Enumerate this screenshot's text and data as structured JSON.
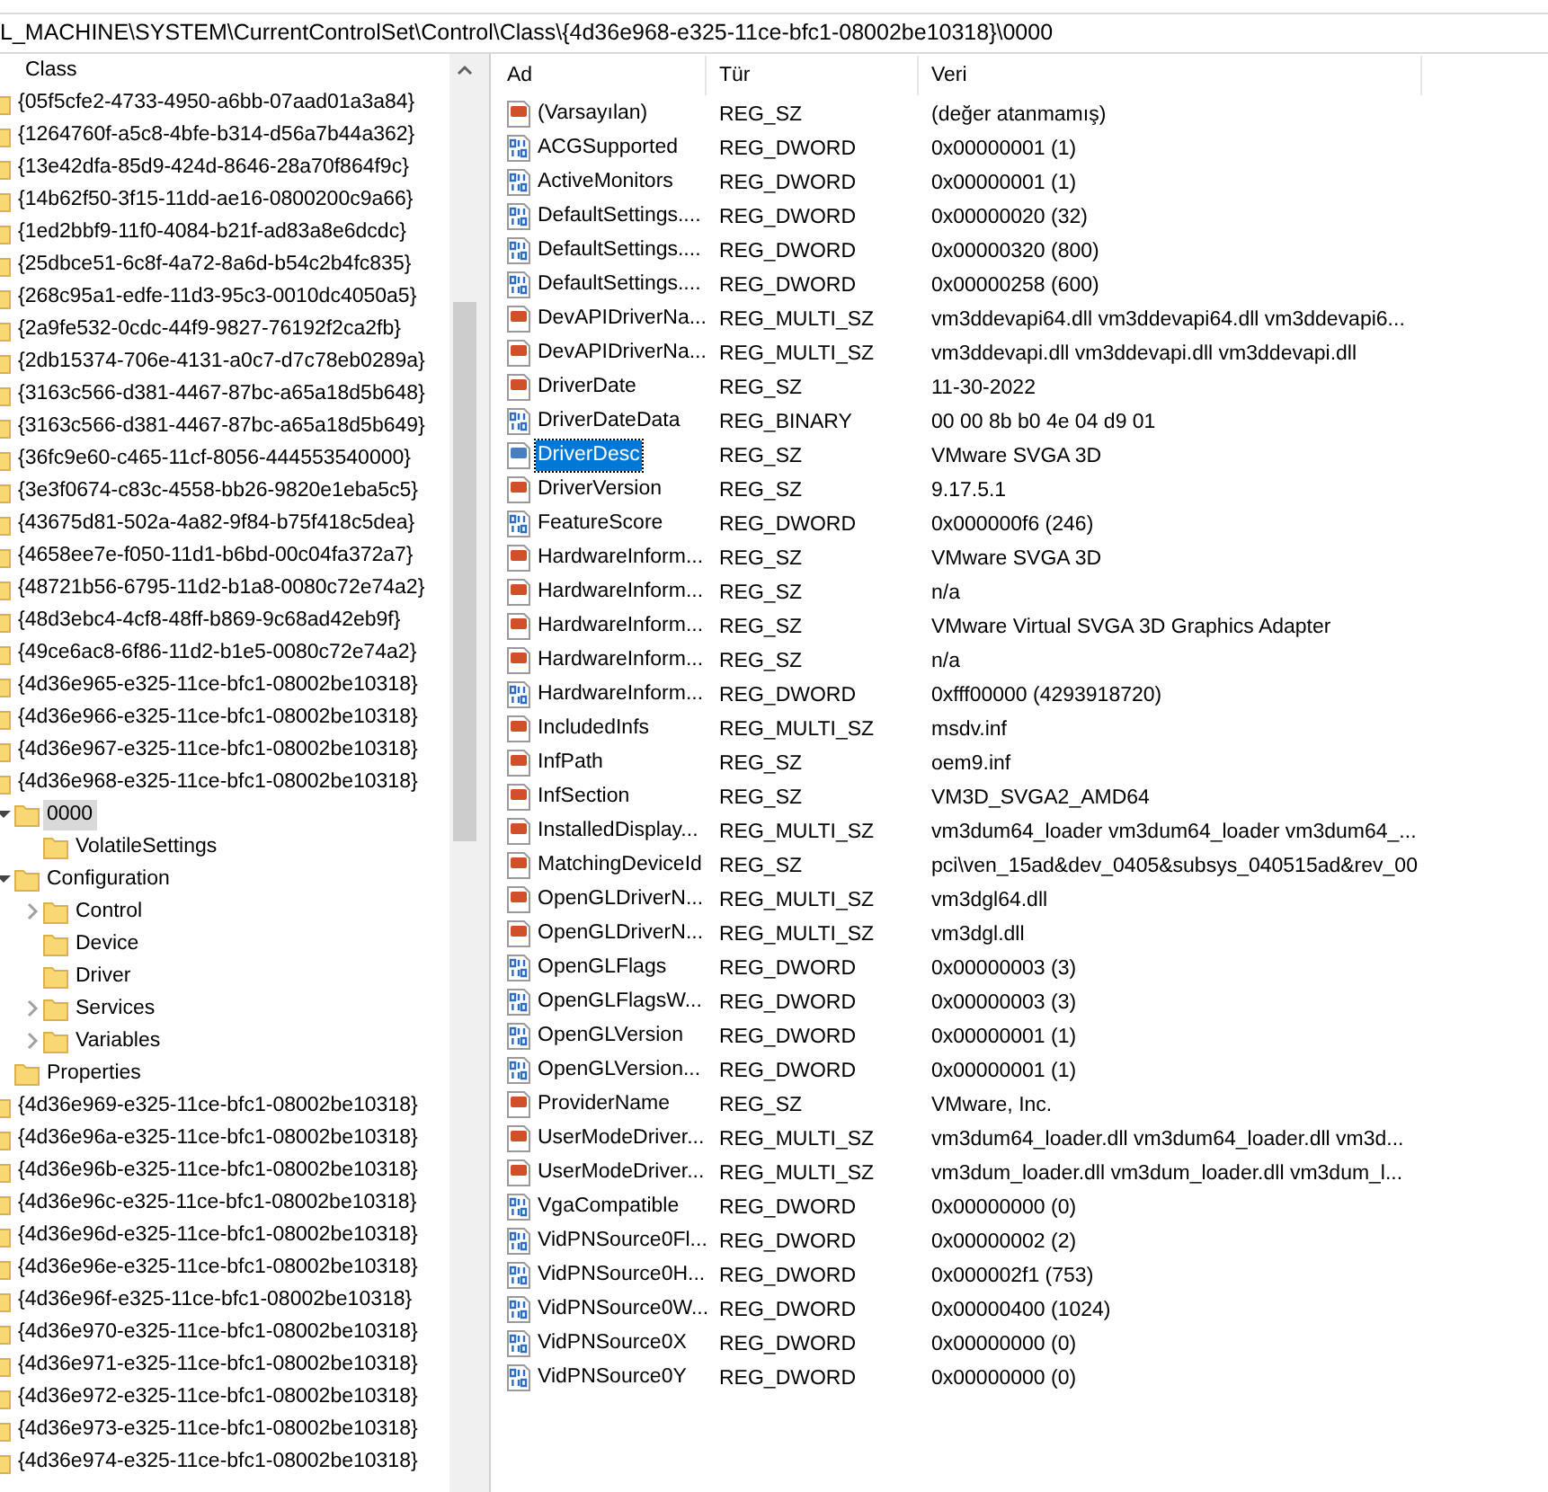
{
  "address_bar": {
    "path": "L_MACHINE\\SYSTEM\\CurrentControlSet\\Control\\Class\\{4d36e968-e325-11ce-bfc1-08002be10318}\\0000"
  },
  "tree": {
    "label": "Class",
    "selected": false,
    "children": [
      {
        "label": "{05f5cfe2-4733-4950-a6bb-07aad01a3a84}",
        "selected": false
      },
      {
        "label": "{1264760f-a5c8-4bfe-b314-d56a7b44a362}",
        "selected": false
      },
      {
        "label": "{13e42dfa-85d9-424d-8646-28a70f864f9c}",
        "selected": false
      },
      {
        "label": "{14b62f50-3f15-11dd-ae16-0800200c9a66}",
        "selected": false
      },
      {
        "label": "{1ed2bbf9-11f0-4084-b21f-ad83a8e6dcdc}",
        "selected": false
      },
      {
        "label": "{25dbce51-6c8f-4a72-8a6d-b54c2b4fc835}",
        "selected": false
      },
      {
        "label": "{268c95a1-edfe-11d3-95c3-0010dc4050a5}",
        "selected": false
      },
      {
        "label": "{2a9fe532-0cdc-44f9-9827-76192f2ca2fb}",
        "selected": false
      },
      {
        "label": "{2db15374-706e-4131-a0c7-d7c78eb0289a}",
        "selected": false
      },
      {
        "label": "{3163c566-d381-4467-87bc-a65a18d5b648}",
        "selected": false
      },
      {
        "label": "{3163c566-d381-4467-87bc-a65a18d5b649}",
        "selected": false
      },
      {
        "label": "{36fc9e60-c465-11cf-8056-444553540000}",
        "selected": false
      },
      {
        "label": "{3e3f0674-c83c-4558-bb26-9820e1eba5c5}",
        "selected": false
      },
      {
        "label": "{43675d81-502a-4a82-9f84-b75f418c5dea}",
        "selected": false
      },
      {
        "label": "{4658ee7e-f050-11d1-b6bd-00c04fa372a7}",
        "selected": false
      },
      {
        "label": "{48721b56-6795-11d2-b1a8-0080c72e74a2}",
        "selected": false
      },
      {
        "label": "{48d3ebc4-4cf8-48ff-b869-9c68ad42eb9f}",
        "selected": false
      },
      {
        "label": "{49ce6ac8-6f86-11d2-b1e5-0080c72e74a2}",
        "selected": false
      },
      {
        "label": "{4d36e965-e325-11ce-bfc1-08002be10318}",
        "selected": false
      },
      {
        "label": "{4d36e966-e325-11ce-bfc1-08002be10318}",
        "selected": false
      },
      {
        "label": "{4d36e967-e325-11ce-bfc1-08002be10318}",
        "selected": false
      },
      {
        "label": "{4d36e968-e325-11ce-bfc1-08002be10318}",
        "selected": false,
        "children": [
          {
            "label": "0000",
            "expanded": true,
            "selected": true,
            "children": [
              {
                "label": "VolatileSettings",
                "selected": false
              }
            ]
          },
          {
            "label": "Configuration",
            "expanded": true,
            "selected": false,
            "children": [
              {
                "label": "Control",
                "expanded": false,
                "selected": false
              },
              {
                "label": "Device",
                "selected": false
              },
              {
                "label": "Driver",
                "selected": false
              },
              {
                "label": "Services",
                "expanded": false,
                "selected": false
              },
              {
                "label": "Variables",
                "expanded": false,
                "selected": false
              }
            ]
          },
          {
            "label": "Properties",
            "selected": false
          }
        ]
      },
      {
        "label": "{4d36e969-e325-11ce-bfc1-08002be10318}",
        "selected": false
      },
      {
        "label": "{4d36e96a-e325-11ce-bfc1-08002be10318}",
        "selected": false
      },
      {
        "label": "{4d36e96b-e325-11ce-bfc1-08002be10318}",
        "selected": false
      },
      {
        "label": "{4d36e96c-e325-11ce-bfc1-08002be10318}",
        "selected": false
      },
      {
        "label": "{4d36e96d-e325-11ce-bfc1-08002be10318}",
        "selected": false
      },
      {
        "label": "{4d36e96e-e325-11ce-bfc1-08002be10318}",
        "selected": false
      },
      {
        "label": "{4d36e96f-e325-11ce-bfc1-08002be10318}",
        "selected": false
      },
      {
        "label": "{4d36e970-e325-11ce-bfc1-08002be10318}",
        "selected": false
      },
      {
        "label": "{4d36e971-e325-11ce-bfc1-08002be10318}",
        "selected": false
      },
      {
        "label": "{4d36e972-e325-11ce-bfc1-08002be10318}",
        "selected": false
      },
      {
        "label": "{4d36e973-e325-11ce-bfc1-08002be10318}",
        "selected": false
      },
      {
        "label": "{4d36e974-e325-11ce-bfc1-08002be10318}",
        "selected": false
      }
    ]
  },
  "values_list": {
    "columns": [
      "Ad",
      "Tür",
      "Veri"
    ],
    "rows": [
      {
        "kind": "string",
        "name": "(Varsayılan)",
        "type": "REG_SZ",
        "data": "(değer atanmamış)",
        "selected": false
      },
      {
        "kind": "binary",
        "name": "ACGSupported",
        "type": "REG_DWORD",
        "data": "0x00000001 (1)",
        "selected": false
      },
      {
        "kind": "binary",
        "name": "ActiveMonitors",
        "type": "REG_DWORD",
        "data": "0x00000001 (1)",
        "selected": false
      },
      {
        "kind": "binary",
        "name": "DefaultSettings....",
        "type": "REG_DWORD",
        "data": "0x00000020 (32)",
        "selected": false
      },
      {
        "kind": "binary",
        "name": "DefaultSettings....",
        "type": "REG_DWORD",
        "data": "0x00000320 (800)",
        "selected": false
      },
      {
        "kind": "binary",
        "name": "DefaultSettings....",
        "type": "REG_DWORD",
        "data": "0x00000258 (600)",
        "selected": false
      },
      {
        "kind": "string",
        "name": "DevAPIDriverNa...",
        "type": "REG_MULTI_SZ",
        "data": "vm3ddevapi64.dll vm3ddevapi64.dll vm3ddevapi6...",
        "selected": false
      },
      {
        "kind": "string",
        "name": "DevAPIDriverNa...",
        "type": "REG_MULTI_SZ",
        "data": "vm3ddevapi.dll vm3ddevapi.dll vm3ddevapi.dll",
        "selected": false
      },
      {
        "kind": "string",
        "name": "DriverDate",
        "type": "REG_SZ",
        "data": "11-30-2022",
        "selected": false
      },
      {
        "kind": "binary",
        "name": "DriverDateData",
        "type": "REG_BINARY",
        "data": "00 00 8b b0 4e 04 d9 01",
        "selected": false
      },
      {
        "kind": "string",
        "name": "DriverDesc",
        "type": "REG_SZ",
        "data": "VMware SVGA 3D",
        "selected": true
      },
      {
        "kind": "string",
        "name": "DriverVersion",
        "type": "REG_SZ",
        "data": "9.17.5.1",
        "selected": false
      },
      {
        "kind": "binary",
        "name": "FeatureScore",
        "type": "REG_DWORD",
        "data": "0x000000f6 (246)",
        "selected": false
      },
      {
        "kind": "string",
        "name": "HardwareInform...",
        "type": "REG_SZ",
        "data": "VMware SVGA 3D",
        "selected": false
      },
      {
        "kind": "string",
        "name": "HardwareInform...",
        "type": "REG_SZ",
        "data": "n/a",
        "selected": false
      },
      {
        "kind": "string",
        "name": "HardwareInform...",
        "type": "REG_SZ",
        "data": "VMware Virtual SVGA 3D Graphics Adapter",
        "selected": false
      },
      {
        "kind": "string",
        "name": "HardwareInform...",
        "type": "REG_SZ",
        "data": "n/a",
        "selected": false
      },
      {
        "kind": "binary",
        "name": "HardwareInform...",
        "type": "REG_DWORD",
        "data": "0xfff00000 (4293918720)",
        "selected": false
      },
      {
        "kind": "string",
        "name": "IncludedInfs",
        "type": "REG_MULTI_SZ",
        "data": "msdv.inf",
        "selected": false
      },
      {
        "kind": "string",
        "name": "InfPath",
        "type": "REG_SZ",
        "data": "oem9.inf",
        "selected": false
      },
      {
        "kind": "string",
        "name": "InfSection",
        "type": "REG_SZ",
        "data": "VM3D_SVGA2_AMD64",
        "selected": false
      },
      {
        "kind": "string",
        "name": "InstalledDisplay...",
        "type": "REG_MULTI_SZ",
        "data": "vm3dum64_loader vm3dum64_loader vm3dum64_...",
        "selected": false
      },
      {
        "kind": "string",
        "name": "MatchingDeviceId",
        "type": "REG_SZ",
        "data": "pci\\ven_15ad&dev_0405&subsys_040515ad&rev_00",
        "selected": false
      },
      {
        "kind": "string",
        "name": "OpenGLDriverN...",
        "type": "REG_MULTI_SZ",
        "data": "vm3dgl64.dll",
        "selected": false
      },
      {
        "kind": "string",
        "name": "OpenGLDriverN...",
        "type": "REG_MULTI_SZ",
        "data": "vm3dgl.dll",
        "selected": false
      },
      {
        "kind": "binary",
        "name": "OpenGLFlags",
        "type": "REG_DWORD",
        "data": "0x00000003 (3)",
        "selected": false
      },
      {
        "kind": "binary",
        "name": "OpenGLFlagsW...",
        "type": "REG_DWORD",
        "data": "0x00000003 (3)",
        "selected": false
      },
      {
        "kind": "binary",
        "name": "OpenGLVersion",
        "type": "REG_DWORD",
        "data": "0x00000001 (1)",
        "selected": false
      },
      {
        "kind": "binary",
        "name": "OpenGLVersion...",
        "type": "REG_DWORD",
        "data": "0x00000001 (1)",
        "selected": false
      },
      {
        "kind": "string",
        "name": "ProviderName",
        "type": "REG_SZ",
        "data": "VMware, Inc.",
        "selected": false
      },
      {
        "kind": "string",
        "name": "UserModeDriver...",
        "type": "REG_MULTI_SZ",
        "data": "vm3dum64_loader.dll vm3dum64_loader.dll vm3d...",
        "selected": false
      },
      {
        "kind": "string",
        "name": "UserModeDriver...",
        "type": "REG_MULTI_SZ",
        "data": "vm3dum_loader.dll vm3dum_loader.dll vm3dum_l...",
        "selected": false
      },
      {
        "kind": "binary",
        "name": "VgaCompatible",
        "type": "REG_DWORD",
        "data": "0x00000000 (0)",
        "selected": false
      },
      {
        "kind": "binary",
        "name": "VidPNSource0Fl...",
        "type": "REG_DWORD",
        "data": "0x00000002 (2)",
        "selected": false
      },
      {
        "kind": "binary",
        "name": "VidPNSource0H...",
        "type": "REG_DWORD",
        "data": "0x000002f1 (753)",
        "selected": false
      },
      {
        "kind": "binary",
        "name": "VidPNSource0W...",
        "type": "REG_DWORD",
        "data": "0x00000400 (1024)",
        "selected": false
      },
      {
        "kind": "binary",
        "name": "VidPNSource0X",
        "type": "REG_DWORD",
        "data": "0x00000000 (0)",
        "selected": false
      },
      {
        "kind": "binary",
        "name": "VidPNSource0Y",
        "type": "REG_DWORD",
        "data": "0x00000000 (0)",
        "selected": false
      }
    ]
  }
}
